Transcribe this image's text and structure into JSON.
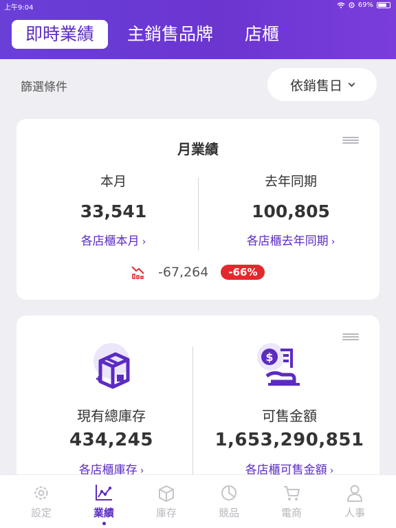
{
  "statusbar": {
    "time": "上午9:04",
    "battery_pct": "69%"
  },
  "header": {
    "tabs": [
      {
        "label": "即時業績",
        "active": true
      },
      {
        "label": "主銷售品牌",
        "active": false
      },
      {
        "label": "店櫃",
        "active": false
      }
    ]
  },
  "filter": {
    "label": "篩選條件",
    "sort_selected": "依銷售日"
  },
  "monthly_card": {
    "title": "月業績",
    "current": {
      "label": "本月",
      "value": "33,541",
      "link": "各店櫃本月"
    },
    "last_year": {
      "label": "去年同期",
      "value": "100,805",
      "link": "各店櫃去年同期"
    },
    "diff": {
      "value": "-67,264",
      "percent": "-66%"
    }
  },
  "inventory_card": {
    "stock": {
      "label": "現有總庫存",
      "value": "434,245",
      "link": "各店櫃庫存"
    },
    "amount": {
      "label": "可售金額",
      "value": "1,653,290,851",
      "link": "各店櫃可售金額"
    }
  },
  "bottom_nav": [
    {
      "label": "設定",
      "icon": "gear-icon",
      "active": false
    },
    {
      "label": "業績",
      "icon": "trend-icon",
      "active": true
    },
    {
      "label": "庫存",
      "icon": "box-icon",
      "active": false
    },
    {
      "label": "競品",
      "icon": "pie-chart-icon",
      "active": false
    },
    {
      "label": "電商",
      "icon": "cart-icon",
      "active": false
    },
    {
      "label": "人事",
      "icon": "person-icon",
      "active": false
    }
  ],
  "colors": {
    "accent": "#5b2bc2",
    "header": "#6a3fd8",
    "negative": "#e3292e",
    "inactive": "#b7b7bd"
  }
}
